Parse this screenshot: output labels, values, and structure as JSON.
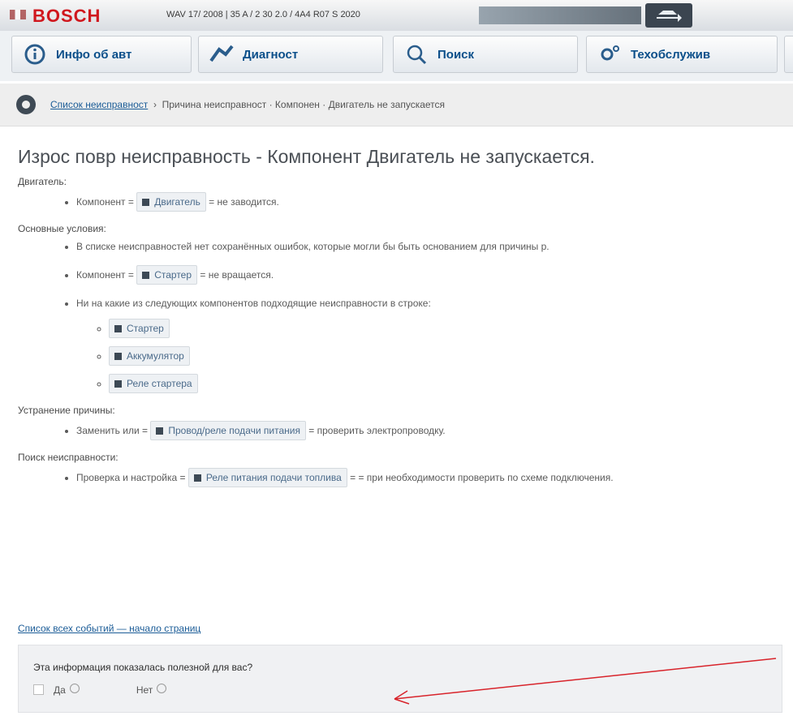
{
  "header": {
    "brand": "BOSCH",
    "vin_text": "WAV 17/ 2008 | 35 A / 2 30 2.0 / 4A4 R07 S 2020"
  },
  "tabs": [
    {
      "label": "Инфо об авт",
      "icon": "info-icon"
    },
    {
      "label": "Диагност",
      "icon": "diagnostics-icon"
    },
    {
      "label": "Поиск",
      "icon": "search-icon"
    },
    {
      "label": "Техобслужив",
      "icon": "maintenance-icon"
    }
  ],
  "breadcrumb": {
    "link": "Список неисправност",
    "rest": "Причина неисправност · Компонен · Двигатель не запускается"
  },
  "page": {
    "title": "Изрос повр неисправность - Компонент Двигатель не запускается.",
    "section1_label": "Двигатель:",
    "section1_items": [
      {
        "pre": "Компонент =",
        "chip": "Двигатель",
        "post": "= не заводится."
      }
    ],
    "section2_label": "Основные условия:",
    "section2_items": [
      {
        "text": "В списке неисправностей нет сохранённых ошибок, которые могли бы быть основанием для причины р."
      },
      {
        "pre": "Компонент =",
        "chip": "Стартер",
        "post": "= не вращается."
      },
      {
        "text": "Ни на какие из следующих компонентов подходящие неисправности в строке:"
      }
    ],
    "section2_subitems": [
      "Стартер",
      "Аккумулятор",
      "Реле стартера"
    ],
    "section3_label": "Устранение причины:",
    "section3_items": [
      {
        "pre": "Заменить или =",
        "chip": "Провод/реле подачи питания",
        "post": "= проверить электропроводку."
      }
    ],
    "section4_label": "Поиск неисправности:",
    "section4_items": [
      {
        "pre": "Проверка и настройка =",
        "chip": "Реле питания подачи топлива",
        "post": "= = при необходимости проверить по схеме подключения."
      }
    ]
  },
  "links": {
    "all_events": "Список всех событий — начало страниц"
  },
  "feedback": {
    "question": "Эта информация показалась полезной для вас?",
    "yes_label": "Да",
    "no_label": "Нет"
  }
}
